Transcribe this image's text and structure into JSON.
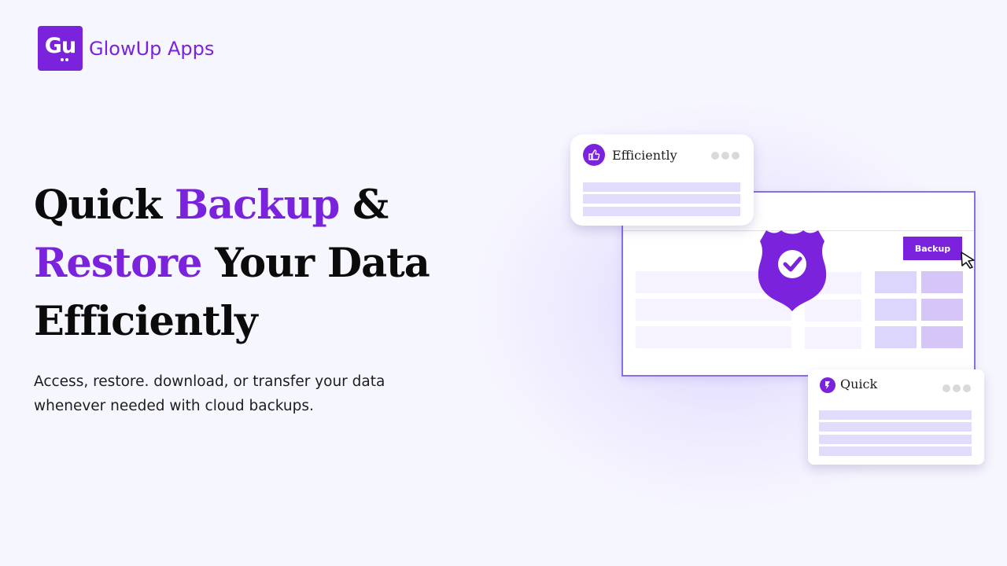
{
  "brand": {
    "mark_text": "Gu",
    "name": "GlowUp Apps",
    "color": "#7b22dc"
  },
  "hero": {
    "headline": {
      "line1_a": "Quick ",
      "line1_accent": "Backup",
      "line1_b": " &",
      "line2_accent": "Restore",
      "line2_b": " Your Data",
      "line3": "Efficiently"
    },
    "subtitle": "Access, restore. download, or transfer your data whenever needed with cloud backups."
  },
  "illustration": {
    "card_top": {
      "title": "Efficiently",
      "icon": "thumbs-up-icon",
      "menu_icon": "more-dots-icon"
    },
    "card_bottom": {
      "title": "Quick",
      "icon": "lightning-icon",
      "menu_icon": "more-dots-icon"
    },
    "browser": {
      "backup_button_label": "Backup",
      "shield_icon": "shield-check-icon",
      "cursor_icon": "mouse-pointer-icon"
    }
  }
}
